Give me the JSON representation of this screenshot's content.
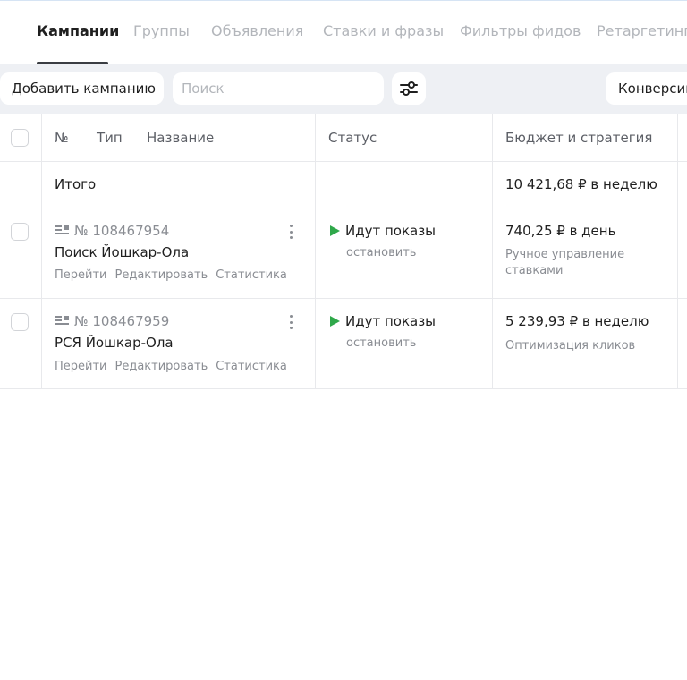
{
  "tabs": [
    {
      "label": "Кампании",
      "active": true
    },
    {
      "label": "Группы"
    },
    {
      "label": "Объявления"
    },
    {
      "label": "Ставки и фразы"
    },
    {
      "label": "Фильтры фидов"
    },
    {
      "label": "Ретаргетинг"
    }
  ],
  "toolbar": {
    "add_label": "Добавить кампанию",
    "search_placeholder": "Поиск",
    "search_value": "",
    "conversions_label": "Конверсии"
  },
  "table": {
    "headers": {
      "num": "№",
      "type": "Тип",
      "name": "Название",
      "status": "Статус",
      "budget": "Бюджет и стратегия"
    },
    "total": {
      "label": "Итого",
      "budget": "10 421,68 ₽ в неделю"
    },
    "rows": [
      {
        "id": "№ 108467954",
        "name": "Поиск Йошкар-Ола",
        "links": [
          "Перейти",
          "Редактировать",
          "Статистика"
        ],
        "status": "Идут показы",
        "status_action": "остановить",
        "budget": "740,25 ₽ в день",
        "strategy_line1": "Ручное управление",
        "strategy_line2": "ставками"
      },
      {
        "id": "№ 108467959",
        "name": "РСЯ Йошкар-Ола",
        "links": [
          "Перейти",
          "Редактировать",
          "Статистика"
        ],
        "status": "Идут показы",
        "status_action": "остановить",
        "budget": "5 239,93 ₽ в неделю",
        "strategy_line1": "Оптимизация кликов",
        "strategy_line2": ""
      }
    ]
  },
  "colors": {
    "accent_play": "#2fa84a",
    "toolbar_bg": "#eef0f4"
  },
  "icons": {
    "filter": "sliders-icon",
    "type": "text-ad-icon",
    "more": "more-vertical-icon",
    "play": "play-icon"
  }
}
